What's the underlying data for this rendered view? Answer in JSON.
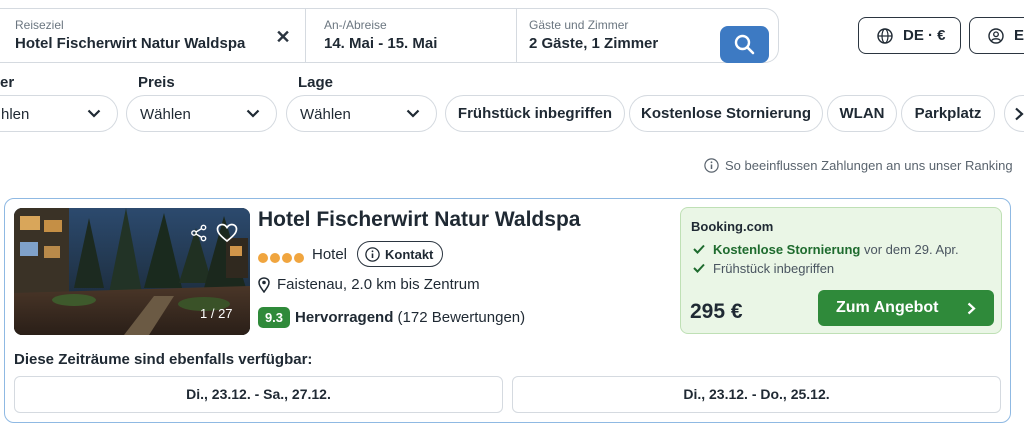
{
  "search": {
    "destination_label": "Reiseziel",
    "destination_value": "Hotel Fischerwirt Natur Waldspa",
    "clear_icon": "✕",
    "dates_label": "An-/Abreise",
    "dates_value": "14. Mai - 15. Mai",
    "guests_label": "Gäste und Zimmer",
    "guests_value": "2 Gäste, 1 Zimmer"
  },
  "header": {
    "language_label": "DE · €",
    "login_label": "Ei"
  },
  "filters": {
    "first_label": "er",
    "first_value": "hlen",
    "price_label": "Preis",
    "price_value": "Wählen",
    "location_label": "Lage",
    "location_value": "Wählen",
    "chips": [
      "Frühstück inbegriffen",
      "Kostenlose Stornierung",
      "WLAN",
      "Parkplatz"
    ]
  },
  "ranking_note": "So beeinflussen Zahlungen an uns unser Ranking",
  "hotel": {
    "name": "Hotel Fischerwirt Natur Waldspa",
    "stars": 4,
    "type": "Hotel",
    "contact_label": "Kontakt",
    "location": "Faistenau, 2.0 km bis Zentrum",
    "photo_counter": "1 / 27",
    "rating_score": "9.3",
    "rating_word": "Hervorragend",
    "rating_count": "(172 Bewertungen)"
  },
  "offer": {
    "provider": "Booking.com",
    "perk1_strong": "Kostenlose Stornierung",
    "perk1_rest": "vor dem 29. Apr.",
    "perk2": "Frühstück inbegriffen",
    "price": "295 €",
    "cta_label": "Zum Angebot"
  },
  "alternatives": {
    "title": "Diese Zeiträume sind ebenfalls verfügbar:",
    "dates": [
      "Di., 23.12. - Sa., 27.12.",
      "Di., 23.12. - Do., 25.12."
    ]
  },
  "colors": {
    "accent_blue": "#3d7ac3",
    "deal_green": "#2f8a3a",
    "star_orange": "#f0a53f"
  }
}
